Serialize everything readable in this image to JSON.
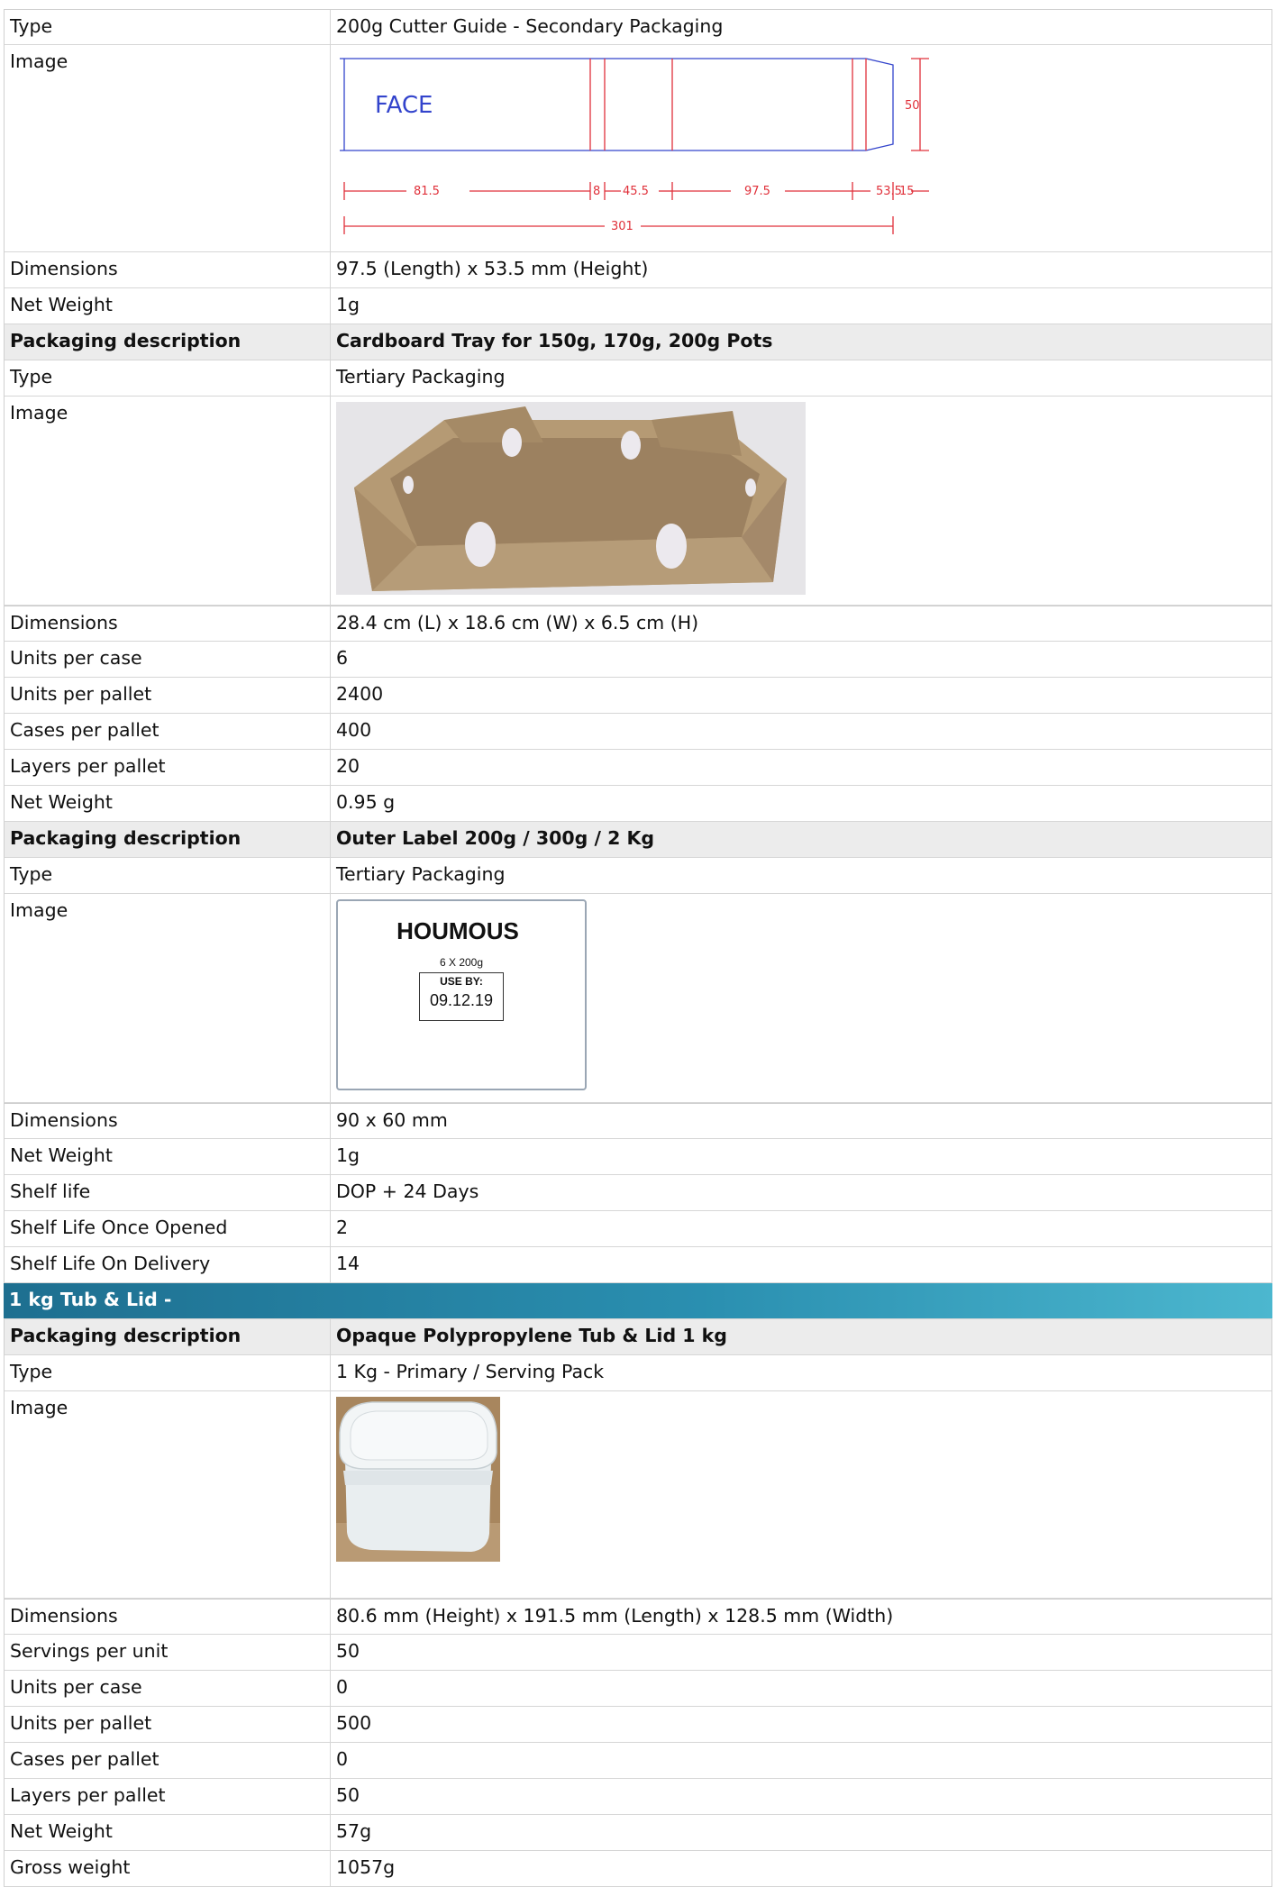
{
  "rows_top": {
    "type_label": "Type",
    "type_value": "200g Cutter Guide - Secondary Packaging",
    "image_label": "Image",
    "cutter_face_text": "FACE",
    "cutter_dims": [
      "81.5",
      "8",
      "45.5",
      "97.5",
      "53.5",
      "15"
    ],
    "cutter_total": "301",
    "cutter_height": "50",
    "dimensions_label": "Dimensions",
    "dimensions_value": "97.5 (Length) x 53.5 mm (Height)",
    "net_weight_label": "Net Weight",
    "net_weight_value": "1g"
  },
  "tray": {
    "header_label": "Packaging description",
    "header_value": "Cardboard Tray for 150g, 170g, 200g Pots",
    "type_label": "Type",
    "type_value": "Tertiary Packaging",
    "image_label": "Image",
    "rows": [
      {
        "label": "Dimensions",
        "value": "28.4 cm (L) x 18.6 cm (W) x 6.5 cm (H)"
      },
      {
        "label": "Units per case",
        "value": "6"
      },
      {
        "label": "Units per pallet",
        "value": "2400"
      },
      {
        "label": "Cases per pallet",
        "value": "400"
      },
      {
        "label": "Layers per pallet",
        "value": "20"
      },
      {
        "label": "Net Weight",
        "value": "0.95 g"
      }
    ]
  },
  "outer_label": {
    "header_label": "Packaging description",
    "header_value": "Outer Label 200g / 300g / 2 Kg",
    "type_label": "Type",
    "type_value": "Tertiary Packaging",
    "image_label": "Image",
    "label_title": "HOUMOUS",
    "label_count": "6 X 200g",
    "label_use_by": "USE BY:",
    "label_date": "09.12.19",
    "rows": [
      {
        "label": "Dimensions",
        "value": "90 x 60 mm"
      },
      {
        "label": "Net Weight",
        "value": "1g"
      },
      {
        "label": "Shelf life",
        "value": "DOP + 24 Days"
      },
      {
        "label": "Shelf Life Once Opened",
        "value": "2"
      },
      {
        "label": "Shelf Life On Delivery",
        "value": "14"
      }
    ]
  },
  "tub_section": {
    "title": "1 kg Tub & Lid -",
    "header_label": "Packaging description",
    "header_value": "Opaque Polypropylene Tub & Lid 1 kg",
    "type_label": "Type",
    "type_value": "1 Kg - Primary / Serving Pack",
    "image_label": "Image",
    "rows": [
      {
        "label": "Dimensions",
        "value": "80.6 mm (Height) x 191.5 mm (Length) x 128.5 mm (Width)"
      },
      {
        "label": "Servings per unit",
        "value": "50"
      },
      {
        "label": "Units per case",
        "value": "0"
      },
      {
        "label": "Units per pallet",
        "value": "500"
      },
      {
        "label": "Cases per pallet",
        "value": "0"
      },
      {
        "label": "Layers per pallet",
        "value": "50"
      },
      {
        "label": "Net Weight",
        "value": "57g"
      },
      {
        "label": "Gross weight",
        "value": "1057g"
      }
    ]
  },
  "colors": {
    "header_bg": "#ececec",
    "section_bg": "#2a8fb0",
    "cutter_red": "#e0303a",
    "cutter_blue": "#3344cc"
  }
}
